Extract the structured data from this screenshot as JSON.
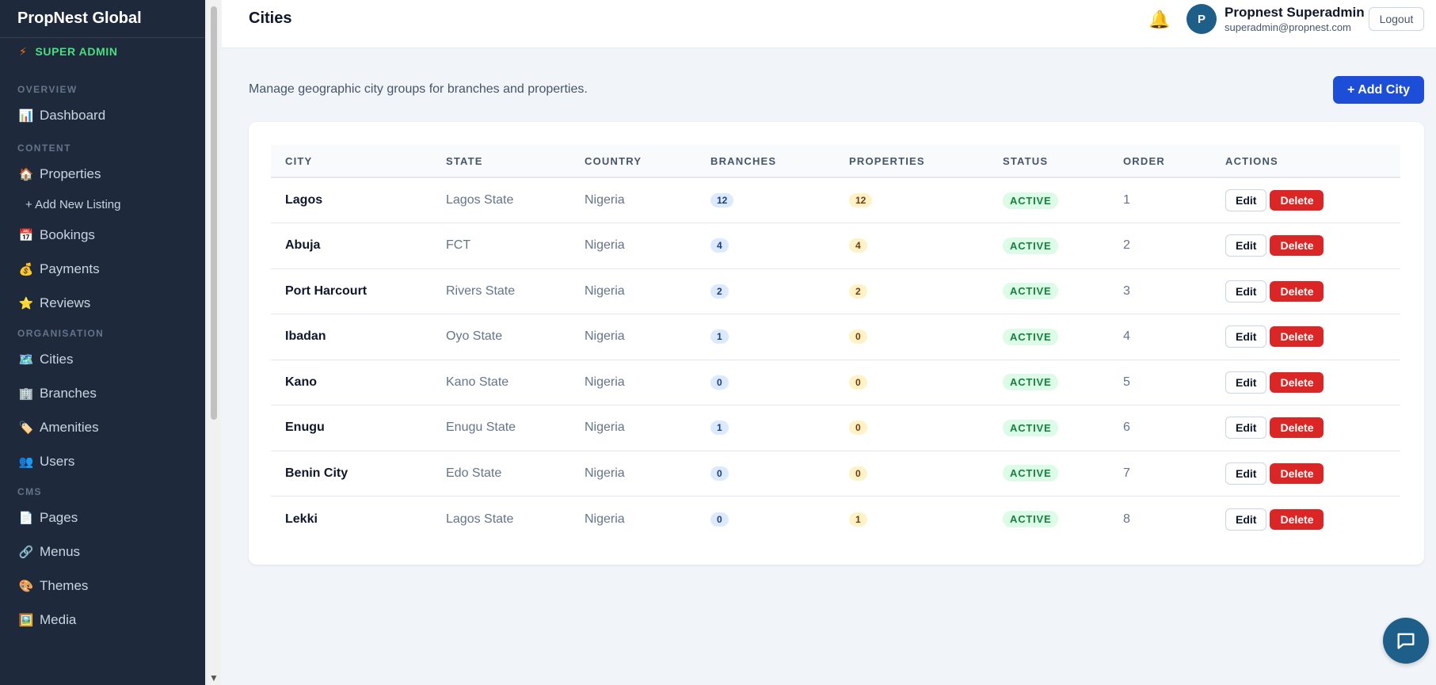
{
  "sidebar": {
    "brand": "PropNest Global",
    "role": "SUPER ADMIN",
    "sections": {
      "overview": "OVERVIEW",
      "content": "CONTENT",
      "organisation": "ORGANISATION",
      "cms": "CMS"
    },
    "items": {
      "dashboard": {
        "icon": "📊",
        "label": "Dashboard"
      },
      "properties": {
        "icon": "🏠",
        "label": "Properties"
      },
      "add_listing": {
        "label": "+ Add New Listing"
      },
      "bookings": {
        "icon": "📅",
        "label": "Bookings"
      },
      "payments": {
        "icon": "💰",
        "label": "Payments"
      },
      "reviews": {
        "icon": "⭐",
        "label": "Reviews"
      },
      "cities": {
        "icon": "🗺️",
        "label": "Cities"
      },
      "branches": {
        "icon": "🏢",
        "label": "Branches"
      },
      "amenities": {
        "icon": "🏷️",
        "label": "Amenities"
      },
      "users": {
        "icon": "👥",
        "label": "Users"
      },
      "pages": {
        "icon": "📄",
        "label": "Pages"
      },
      "menus": {
        "icon": "🔗",
        "label": "Menus"
      },
      "themes": {
        "icon": "🎨",
        "label": "Themes"
      },
      "media": {
        "icon": "🖼️",
        "label": "Media"
      }
    }
  },
  "header": {
    "title": "Cities",
    "user_initial": "P",
    "user_name": "Propnest Superadmin",
    "user_email": "superadmin@propnest.com",
    "logout_label": "Logout"
  },
  "main": {
    "subtitle": "Manage geographic city groups for branches and properties.",
    "add_button": "+ Add City",
    "columns": [
      "CITY",
      "STATE",
      "COUNTRY",
      "BRANCHES",
      "PROPERTIES",
      "STATUS",
      "ORDER",
      "ACTIONS"
    ],
    "rows": [
      {
        "city": "Lagos",
        "state": "Lagos State",
        "country": "Nigeria",
        "branches": "12",
        "properties": "12",
        "status": "ACTIVE",
        "order": "1"
      },
      {
        "city": "Abuja",
        "state": "FCT",
        "country": "Nigeria",
        "branches": "4",
        "properties": "4",
        "status": "ACTIVE",
        "order": "2"
      },
      {
        "city": "Port Harcourt",
        "state": "Rivers State",
        "country": "Nigeria",
        "branches": "2",
        "properties": "2",
        "status": "ACTIVE",
        "order": "3"
      },
      {
        "city": "Ibadan",
        "state": "Oyo State",
        "country": "Nigeria",
        "branches": "1",
        "properties": "0",
        "status": "ACTIVE",
        "order": "4"
      },
      {
        "city": "Kano",
        "state": "Kano State",
        "country": "Nigeria",
        "branches": "0",
        "properties": "0",
        "status": "ACTIVE",
        "order": "5"
      },
      {
        "city": "Enugu",
        "state": "Enugu State",
        "country": "Nigeria",
        "branches": "1",
        "properties": "0",
        "status": "ACTIVE",
        "order": "6"
      },
      {
        "city": "Benin City",
        "state": "Edo State",
        "country": "Nigeria",
        "branches": "0",
        "properties": "0",
        "status": "ACTIVE",
        "order": "7"
      },
      {
        "city": "Lekki",
        "state": "Lagos State",
        "country": "Nigeria",
        "branches": "0",
        "properties": "1",
        "status": "ACTIVE",
        "order": "8"
      }
    ],
    "edit_label": "Edit",
    "delete_label": "Delete"
  },
  "colors": {
    "sidebar_bg": "#1e293b",
    "primary": "#1d4ed8",
    "danger": "#dc2626",
    "success": "#15803d"
  }
}
